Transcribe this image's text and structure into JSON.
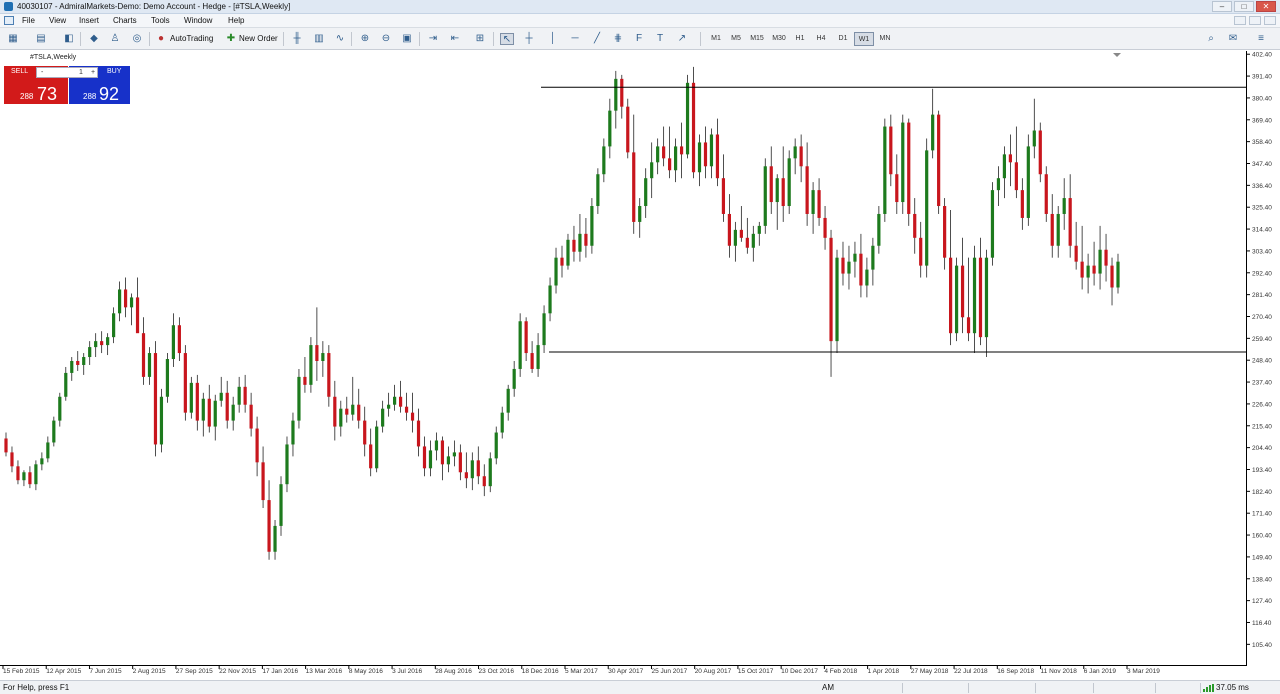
{
  "window": {
    "title": "40030107 - AdmiralMarkets-Demo: Demo Account - Hedge - [#TSLA,Weekly]"
  },
  "menu": [
    "File",
    "View",
    "Insert",
    "Charts",
    "Tools",
    "Window",
    "Help"
  ],
  "toolbar": {
    "autotrading_label": "AutoTrading",
    "new_order_label": "New Order",
    "timeframes": [
      "M1",
      "M5",
      "M15",
      "M30",
      "H1",
      "H4",
      "D1",
      "W1",
      "MN"
    ],
    "active_timeframe": "W1"
  },
  "chart": {
    "symbol_label": "#TSLA,Weekly",
    "one_click": {
      "sell_label": "SELL",
      "buy_label": "BUY",
      "volume": "1",
      "sell_small": "288",
      "sell_big": "73",
      "buy_small": "288",
      "buy_big": "92"
    }
  },
  "chart_data": {
    "type": "candlestick",
    "ylim": [
      95,
      401
    ],
    "y_ticks": [
      "402.40",
      "391.40",
      "380.40",
      "369.40",
      "358.40",
      "347.40",
      "336.40",
      "325.40",
      "314.40",
      "303.40",
      "292.40",
      "281.40",
      "270.40",
      "259.40",
      "248.40",
      "237.40",
      "226.40",
      "215.40",
      "204.40",
      "193.40",
      "182.40",
      "171.40",
      "160.40",
      "149.40",
      "138.40",
      "127.40",
      "116.40",
      "105.40"
    ],
    "x_labels": [
      "15 Feb 2015",
      "12 Apr 2015",
      "7 Jun 2015",
      "2 Aug 2015",
      "27 Sep 2015",
      "22 Nov 2015",
      "17 Jan 2016",
      "13 Mar 2016",
      "8 May 2016",
      "3 Jul 2016",
      "28 Aug 2016",
      "23 Oct 2016",
      "18 Dec 2016",
      "5 Mar 2017",
      "30 Apr 2017",
      "25 Jun 2017",
      "20 Aug 2017",
      "15 Oct 2017",
      "10 Dec 2017",
      "4 Feb 2018",
      "1 Apr 2018",
      "27 May 2018",
      "22 Jul 2018",
      "16 Sep 2018",
      "11 Nov 2018",
      "6 Jan 2019",
      "3 Mar 2019"
    ],
    "horizontal_lines": [
      {
        "price": 385.8
      },
      {
        "price": 252.5
      }
    ],
    "candles": [
      [
        209,
        212,
        200,
        202
      ],
      [
        202,
        205,
        192,
        195
      ],
      [
        195,
        198,
        186,
        188
      ],
      [
        188,
        193,
        185,
        192
      ],
      [
        192,
        195,
        184,
        186
      ],
      [
        186,
        198,
        183,
        196
      ],
      [
        196,
        202,
        193,
        199
      ],
      [
        199,
        210,
        197,
        207
      ],
      [
        207,
        220,
        205,
        218
      ],
      [
        218,
        232,
        215,
        230
      ],
      [
        230,
        245,
        228,
        242
      ],
      [
        242,
        250,
        238,
        248
      ],
      [
        248,
        253,
        243,
        246
      ],
      [
        246,
        252,
        241,
        250
      ],
      [
        250,
        258,
        246,
        255
      ],
      [
        255,
        262,
        250,
        258
      ],
      [
        258,
        263,
        252,
        256
      ],
      [
        256,
        262,
        251,
        260
      ],
      [
        260,
        275,
        257,
        272
      ],
      [
        272,
        288,
        268,
        284
      ],
      [
        284,
        290,
        270,
        275
      ],
      [
        275,
        282,
        266,
        280
      ],
      [
        280,
        290,
        271,
        262
      ],
      [
        262,
        270,
        236,
        240
      ],
      [
        240,
        255,
        236,
        252
      ],
      [
        252,
        258,
        200,
        206
      ],
      [
        206,
        234,
        202,
        230
      ],
      [
        230,
        252,
        227,
        249
      ],
      [
        249,
        272,
        245,
        266
      ],
      [
        266,
        270,
        248,
        252
      ],
      [
        252,
        256,
        218,
        222
      ],
      [
        222,
        240,
        219,
        237
      ],
      [
        237,
        241,
        213,
        218
      ],
      [
        218,
        232,
        210,
        229
      ],
      [
        229,
        236,
        212,
        215
      ],
      [
        215,
        231,
        208,
        228
      ],
      [
        228,
        240,
        225,
        232
      ],
      [
        232,
        238,
        214,
        218
      ],
      [
        218,
        230,
        213,
        226
      ],
      [
        226,
        240,
        222,
        235
      ],
      [
        235,
        241,
        222,
        226
      ],
      [
        226,
        232,
        210,
        214
      ],
      [
        214,
        220,
        190,
        197
      ],
      [
        197,
        205,
        174,
        178
      ],
      [
        178,
        188,
        148,
        152
      ],
      [
        152,
        168,
        148,
        165
      ],
      [
        165,
        190,
        160,
        186
      ],
      [
        186,
        210,
        182,
        206
      ],
      [
        206,
        222,
        200,
        218
      ],
      [
        218,
        244,
        214,
        240
      ],
      [
        240,
        250,
        232,
        236
      ],
      [
        236,
        260,
        232,
        256
      ],
      [
        256,
        275,
        238,
        248
      ],
      [
        248,
        258,
        240,
        252
      ],
      [
        252,
        256,
        225,
        230
      ],
      [
        230,
        238,
        208,
        215
      ],
      [
        215,
        228,
        210,
        224
      ],
      [
        224,
        230,
        217,
        221
      ],
      [
        221,
        240,
        218,
        226
      ],
      [
        226,
        234,
        214,
        218
      ],
      [
        218,
        225,
        200,
        206
      ],
      [
        206,
        214,
        190,
        194
      ],
      [
        194,
        218,
        192,
        215
      ],
      [
        215,
        228,
        212,
        224
      ],
      [
        224,
        232,
        220,
        226
      ],
      [
        226,
        236,
        223,
        230
      ],
      [
        230,
        238,
        222,
        225
      ],
      [
        225,
        232,
        218,
        222
      ],
      [
        222,
        232,
        212,
        218
      ],
      [
        218,
        224,
        200,
        205
      ],
      [
        205,
        210,
        190,
        194
      ],
      [
        194,
        208,
        190,
        203
      ],
      [
        203,
        212,
        198,
        208
      ],
      [
        208,
        210,
        188,
        196
      ],
      [
        196,
        205,
        192,
        200
      ],
      [
        200,
        208,
        195,
        202
      ],
      [
        202,
        206,
        188,
        192
      ],
      [
        192,
        202,
        184,
        189
      ],
      [
        189,
        202,
        183,
        198
      ],
      [
        198,
        205,
        186,
        190
      ],
      [
        190,
        196,
        180,
        185
      ],
      [
        185,
        202,
        182,
        199
      ],
      [
        199,
        215,
        196,
        212
      ],
      [
        212,
        225,
        209,
        222
      ],
      [
        222,
        236,
        218,
        234
      ],
      [
        234,
        248,
        230,
        244
      ],
      [
        244,
        272,
        240,
        268
      ],
      [
        268,
        270,
        248,
        252
      ],
      [
        252,
        258,
        242,
        244
      ],
      [
        244,
        262,
        240,
        256
      ],
      [
        256,
        276,
        252,
        272
      ],
      [
        272,
        290,
        268,
        286
      ],
      [
        286,
        305,
        282,
        300
      ],
      [
        300,
        306,
        290,
        296
      ],
      [
        296,
        312,
        294,
        309
      ],
      [
        309,
        316,
        298,
        303
      ],
      [
        303,
        322,
        298,
        312
      ],
      [
        312,
        320,
        300,
        306
      ],
      [
        306,
        330,
        302,
        326
      ],
      [
        326,
        345,
        322,
        342
      ],
      [
        342,
        360,
        338,
        356
      ],
      [
        356,
        380,
        350,
        374
      ],
      [
        374,
        394,
        365,
        390
      ],
      [
        390,
        392,
        370,
        376
      ],
      [
        376,
        380,
        350,
        353
      ],
      [
        353,
        372,
        312,
        318
      ],
      [
        318,
        330,
        310,
        326
      ],
      [
        326,
        345,
        320,
        340
      ],
      [
        340,
        358,
        330,
        348
      ],
      [
        348,
        360,
        342,
        356
      ],
      [
        356,
        366,
        346,
        350
      ],
      [
        350,
        366,
        340,
        344
      ],
      [
        344,
        360,
        338,
        356
      ],
      [
        356,
        368,
        340,
        352
      ],
      [
        352,
        392,
        350,
        388
      ],
      [
        388,
        396,
        340,
        343
      ],
      [
        343,
        362,
        336,
        358
      ],
      [
        358,
        366,
        340,
        346
      ],
      [
        346,
        365,
        340,
        362
      ],
      [
        362,
        370,
        336,
        340
      ],
      [
        340,
        352,
        318,
        322
      ],
      [
        322,
        332,
        300,
        306
      ],
      [
        306,
        318,
        298,
        314
      ],
      [
        314,
        326,
        308,
        310
      ],
      [
        310,
        320,
        302,
        305
      ],
      [
        305,
        316,
        298,
        312
      ],
      [
        312,
        318,
        306,
        316
      ],
      [
        316,
        350,
        312,
        346
      ],
      [
        346,
        356,
        322,
        328
      ],
      [
        328,
        342,
        314,
        340
      ],
      [
        340,
        356,
        318,
        326
      ],
      [
        326,
        354,
        322,
        350
      ],
      [
        350,
        360,
        342,
        356
      ],
      [
        356,
        362,
        338,
        346
      ],
      [
        346,
        358,
        316,
        322
      ],
      [
        322,
        338,
        312,
        334
      ],
      [
        334,
        340,
        316,
        320
      ],
      [
        320,
        326,
        304,
        310
      ],
      [
        310,
        314,
        240,
        258
      ],
      [
        258,
        304,
        252,
        300
      ],
      [
        300,
        308,
        286,
        292
      ],
      [
        292,
        306,
        284,
        298
      ],
      [
        298,
        308,
        290,
        302
      ],
      [
        302,
        312,
        280,
        286
      ],
      [
        286,
        300,
        280,
        294
      ],
      [
        294,
        310,
        286,
        306
      ],
      [
        306,
        326,
        302,
        322
      ],
      [
        322,
        370,
        318,
        366
      ],
      [
        366,
        372,
        336,
        342
      ],
      [
        342,
        352,
        322,
        328
      ],
      [
        328,
        372,
        322,
        368
      ],
      [
        368,
        370,
        316,
        322
      ],
      [
        322,
        330,
        302,
        310
      ],
      [
        310,
        318,
        290,
        296
      ],
      [
        296,
        360,
        290,
        354
      ],
      [
        354,
        385,
        350,
        372
      ],
      [
        372,
        374,
        322,
        326
      ],
      [
        326,
        330,
        294,
        300
      ],
      [
        300,
        324,
        256,
        262
      ],
      [
        262,
        300,
        258,
        296
      ],
      [
        296,
        310,
        262,
        270
      ],
      [
        270,
        300,
        258,
        262
      ],
      [
        262,
        306,
        252,
        300
      ],
      [
        300,
        310,
        256,
        260
      ],
      [
        260,
        304,
        250,
        300
      ],
      [
        300,
        338,
        296,
        334
      ],
      [
        334,
        346,
        326,
        340
      ],
      [
        340,
        356,
        330,
        352
      ],
      [
        352,
        362,
        336,
        348
      ],
      [
        348,
        366,
        330,
        334
      ],
      [
        334,
        340,
        314,
        320
      ],
      [
        320,
        362,
        316,
        356
      ],
      [
        356,
        380,
        350,
        364
      ],
      [
        364,
        368,
        338,
        342
      ],
      [
        342,
        346,
        318,
        322
      ],
      [
        322,
        332,
        300,
        306
      ],
      [
        306,
        326,
        300,
        322
      ],
      [
        322,
        340,
        314,
        330
      ],
      [
        330,
        342,
        300,
        306
      ],
      [
        306,
        318,
        294,
        298
      ],
      [
        298,
        316,
        284,
        290
      ],
      [
        290,
        302,
        282,
        296
      ],
      [
        296,
        308,
        286,
        292
      ],
      [
        292,
        316,
        284,
        304
      ],
      [
        304,
        312,
        288,
        296
      ],
      [
        296,
        300,
        276,
        285
      ],
      [
        285,
        302,
        282,
        298
      ]
    ]
  },
  "statusbar": {
    "help_text": "For Help, press F1",
    "profile": "AM",
    "traffic": "37.05 ms"
  }
}
